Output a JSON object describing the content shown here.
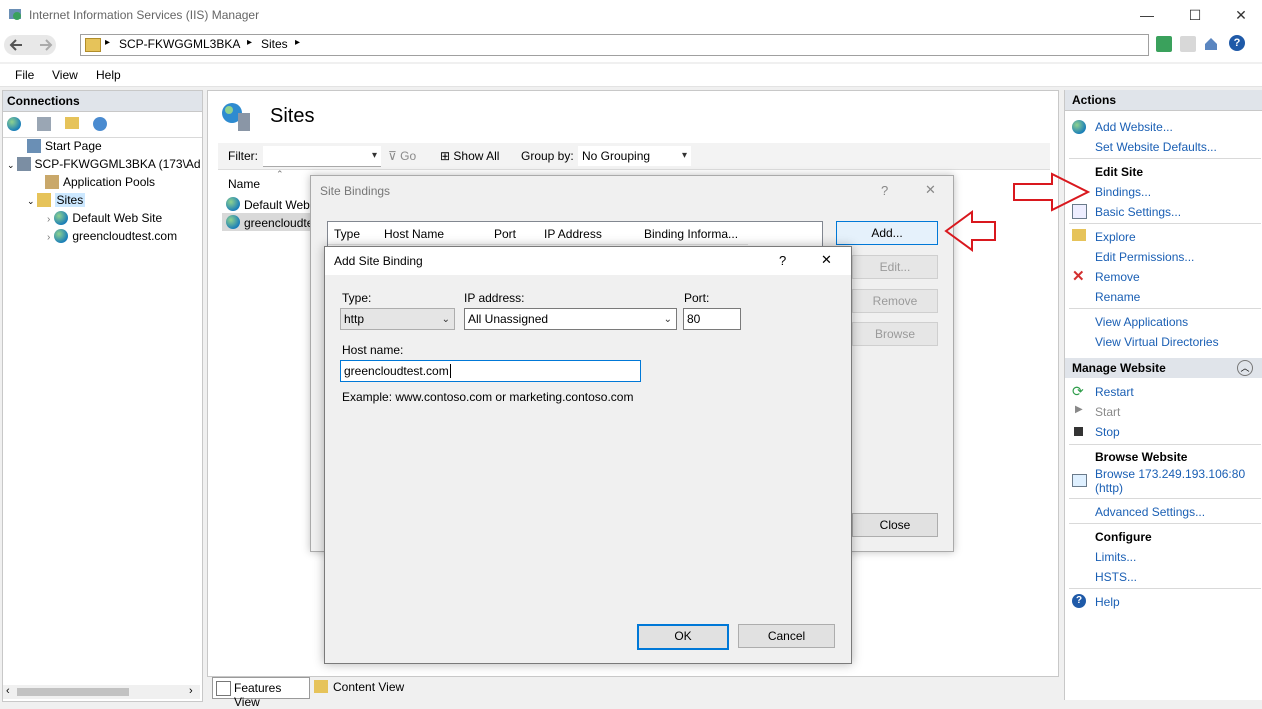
{
  "window": {
    "title": "Internet Information Services (IIS) Manager",
    "min": "—",
    "max": "☐",
    "close": "✕"
  },
  "address": {
    "crumbs": [
      "SCP-FKWGGML3BKA",
      "Sites"
    ],
    "sep": "▸"
  },
  "menu": [
    "File",
    "View",
    "Help"
  ],
  "connections": {
    "title": "Connections",
    "tree": {
      "start_page": "Start Page",
      "server": "SCP-FKWGGML3BKA (173\\Ad",
      "app_pools": "Application Pools",
      "sites": "Sites",
      "site1": "Default Web Site",
      "site2": "greencloudtest.com"
    }
  },
  "main": {
    "title": "Sites",
    "filter_label": "Filter:",
    "go": "Go",
    "show_all": "Show All",
    "group_by_label": "Group by:",
    "group_by_value": "No Grouping",
    "col_name": "Name",
    "rows": [
      "Default Web",
      "greencloudte"
    ],
    "features_view": "Features View",
    "content_view": "Content View"
  },
  "site_bindings": {
    "title": "Site Bindings",
    "help": "?",
    "close_x": "✕",
    "cols": [
      "Type",
      "Host Name",
      "Port",
      "IP Address",
      "Binding Informa..."
    ],
    "add": "Add...",
    "edit": "Edit...",
    "remove": "Remove",
    "browse": "Browse",
    "close": "Close"
  },
  "add_binding": {
    "title": "Add Site Binding",
    "help": "?",
    "close_x": "✕",
    "type_label": "Type:",
    "type_value": "http",
    "ip_label": "IP address:",
    "ip_value": "All Unassigned",
    "port_label": "Port:",
    "port_value": "80",
    "host_label": "Host name:",
    "host_value": "greencloudtest.com",
    "example": "Example: www.contoso.com or marketing.contoso.com",
    "ok": "OK",
    "cancel": "Cancel"
  },
  "actions": {
    "title": "Actions",
    "add_website": "Add Website...",
    "set_defaults": "Set Website Defaults...",
    "edit_site": "Edit Site",
    "bindings": "Bindings...",
    "basic_settings": "Basic Settings...",
    "explore": "Explore",
    "edit_permissions": "Edit Permissions...",
    "remove": "Remove",
    "rename": "Rename",
    "view_applications": "View Applications",
    "view_vdirs": "View Virtual Directories",
    "manage_website": "Manage Website",
    "restart": "Restart",
    "start": "Start",
    "stop": "Stop",
    "browse_website": "Browse Website",
    "browse_link": "Browse 173.249.193.106:80",
    "browse_link2": "(http)",
    "advanced_settings": "Advanced Settings...",
    "configure": "Configure",
    "limits": "Limits...",
    "hsts": "HSTS...",
    "help": "Help"
  },
  "colors": {
    "link": "#1a5fb4",
    "arrow": "#d9181e"
  }
}
